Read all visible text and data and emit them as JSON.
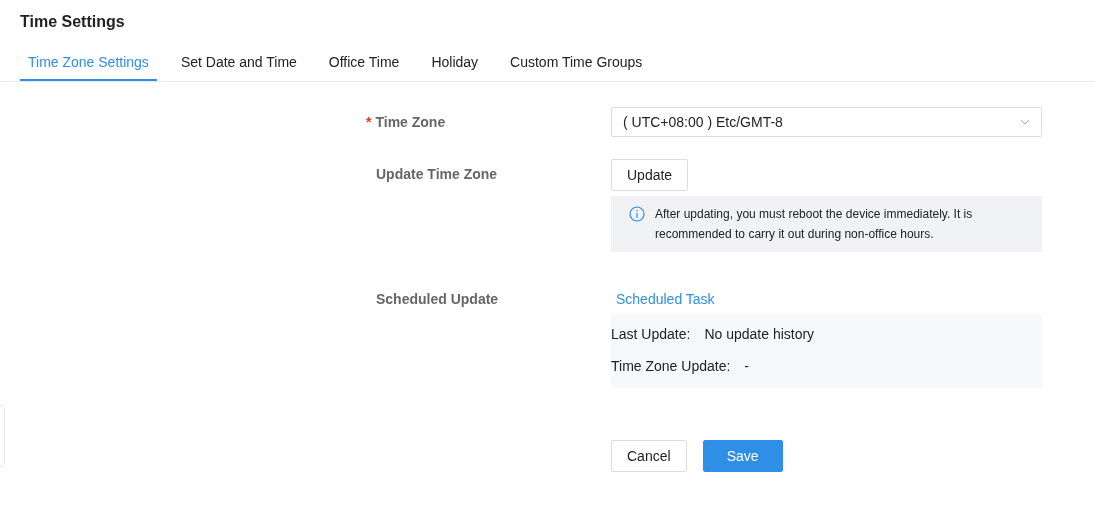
{
  "title": "Time Settings",
  "tabs": [
    {
      "label": "Time Zone Settings",
      "selected": true
    },
    {
      "label": "Set Date and Time",
      "selected": false
    },
    {
      "label": "Office Time",
      "selected": false
    },
    {
      "label": "Holiday",
      "selected": false
    },
    {
      "label": "Custom Time Groups",
      "selected": false
    }
  ],
  "time_zone": {
    "label": "Time Zone",
    "required_mark": "*",
    "value": "( UTC+08:00 ) Etc/GMT-8"
  },
  "update_time_zone": {
    "label": "Update Time Zone",
    "button": "Update",
    "notice": "After updating, you must reboot the device immediately. It is recommended to carry it out during non-office hours."
  },
  "scheduled_update": {
    "label": "Scheduled Update",
    "link": "Scheduled Task",
    "details": [
      {
        "label": "Last Update:",
        "value": "No update history"
      },
      {
        "label": "Time Zone Update:",
        "value": "-"
      }
    ]
  },
  "buttons": [
    {
      "label": "Cancel",
      "kind": "secondary"
    },
    {
      "label": "Save",
      "kind": "primary"
    }
  ]
}
